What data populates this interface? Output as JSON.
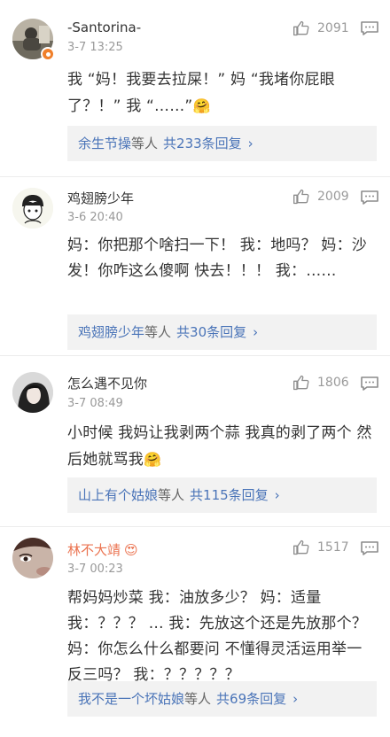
{
  "comments": [
    {
      "username": "-Santorina-",
      "time": "3-7 13:25",
      "likes": "2091",
      "text": "我 “妈！我要去拉屎！” 妈 “我堵你屁眼了？！” 我 “……”",
      "text_emoji": "🤗",
      "replies": {
        "name": "余生节操",
        "middle": "等人",
        "count": "共233条回复",
        "chevron": "›"
      }
    },
    {
      "username": "鸡翅膀少年",
      "time": "3-6 20:40",
      "likes": "2009",
      "text": "妈：你把那个啥扫一下！    我：地吗？    妈：沙发！你咋这么傻啊 快去！！！    我：……",
      "replies": {
        "name": "鸡翅膀少年",
        "middle": "等人",
        "count": "共30条回复",
        "chevron": "›"
      }
    },
    {
      "username": "怎么遇不见你",
      "time": "3-7 08:49",
      "likes": "1806",
      "text": "小时候 我妈让我剥两个蒜 我真的剥了两个 然后她就骂我",
      "text_emoji": "🤗",
      "replies": {
        "name": "山上有个姑娘",
        "middle": "等人",
        "count": "共115条回复",
        "chevron": "›"
      }
    },
    {
      "username": "林不大靖",
      "username_emoji": "😍",
      "time": "3-7 00:23",
      "likes": "1517",
      "text": "帮妈妈炒菜 我：油放多少？ 妈：适量    我：？？？ … 我：先放这个还是先放那个？ 妈：你怎么什么都要问 不懂得灵活运用举一反三吗？ 我：？？？？？",
      "replies": {
        "name": "我不是一个坏姑娘",
        "middle": "等人",
        "count": "共69条回复",
        "chevron": "›"
      }
    }
  ]
}
